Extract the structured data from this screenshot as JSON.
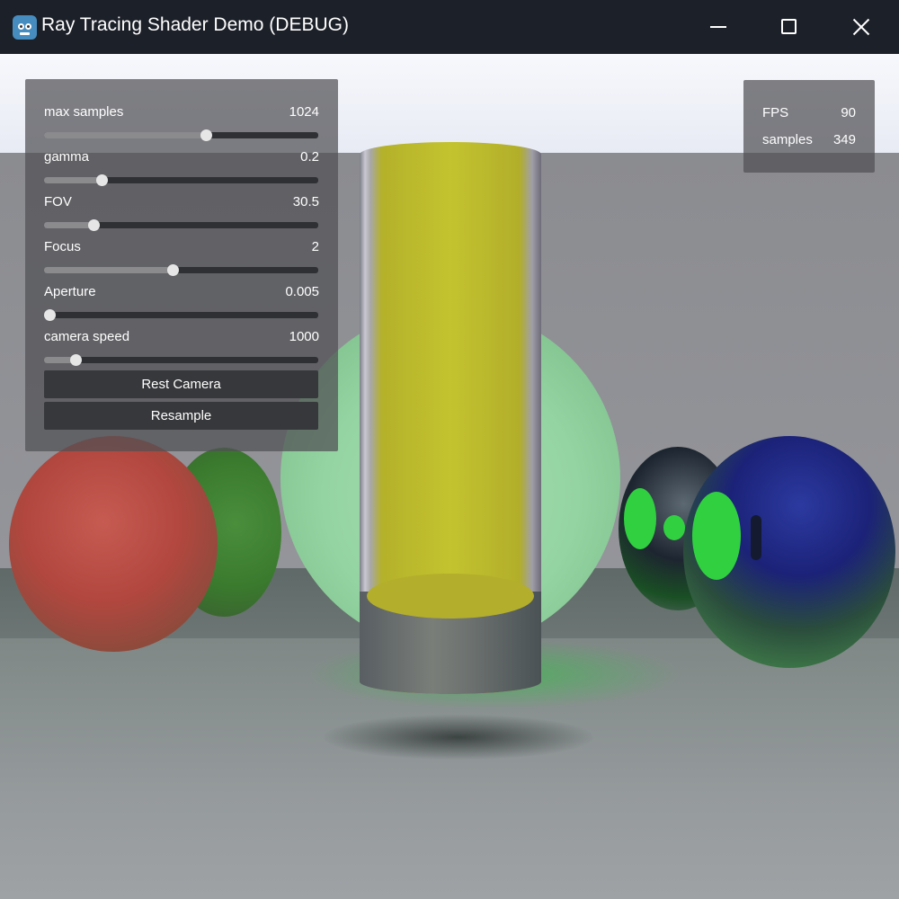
{
  "window": {
    "title": "Ray Tracing Shader Demo (DEBUG)",
    "app_icon": "godot-icon",
    "controls": {
      "minimize": "minimize-icon",
      "maximize": "maximize-icon",
      "close": "close-icon"
    }
  },
  "settings": {
    "sliders": [
      {
        "label": "max samples",
        "value": "1024",
        "level": 0.59
      },
      {
        "label": "gamma",
        "value": "0.2",
        "level": 0.21
      },
      {
        "label": "FOV",
        "value": "30.5",
        "level": 0.18
      },
      {
        "label": "Focus",
        "value": "2",
        "level": 0.47
      },
      {
        "label": "Aperture",
        "value": "0.005",
        "level": 0.02
      },
      {
        "label": "camera speed",
        "value": "1000",
        "level": 0.115
      }
    ],
    "buttons": {
      "reset_camera": "Rest Camera",
      "resample": "Resample"
    }
  },
  "stats": {
    "fps_label": "FPS",
    "fps_value": "90",
    "samples_label": "samples",
    "samples_value": "349"
  },
  "colors": {
    "panel": "#505054",
    "button": "#37383b",
    "track": "#2f3033",
    "knob": "#e6e6e6",
    "titlebar": "#1c2029"
  }
}
